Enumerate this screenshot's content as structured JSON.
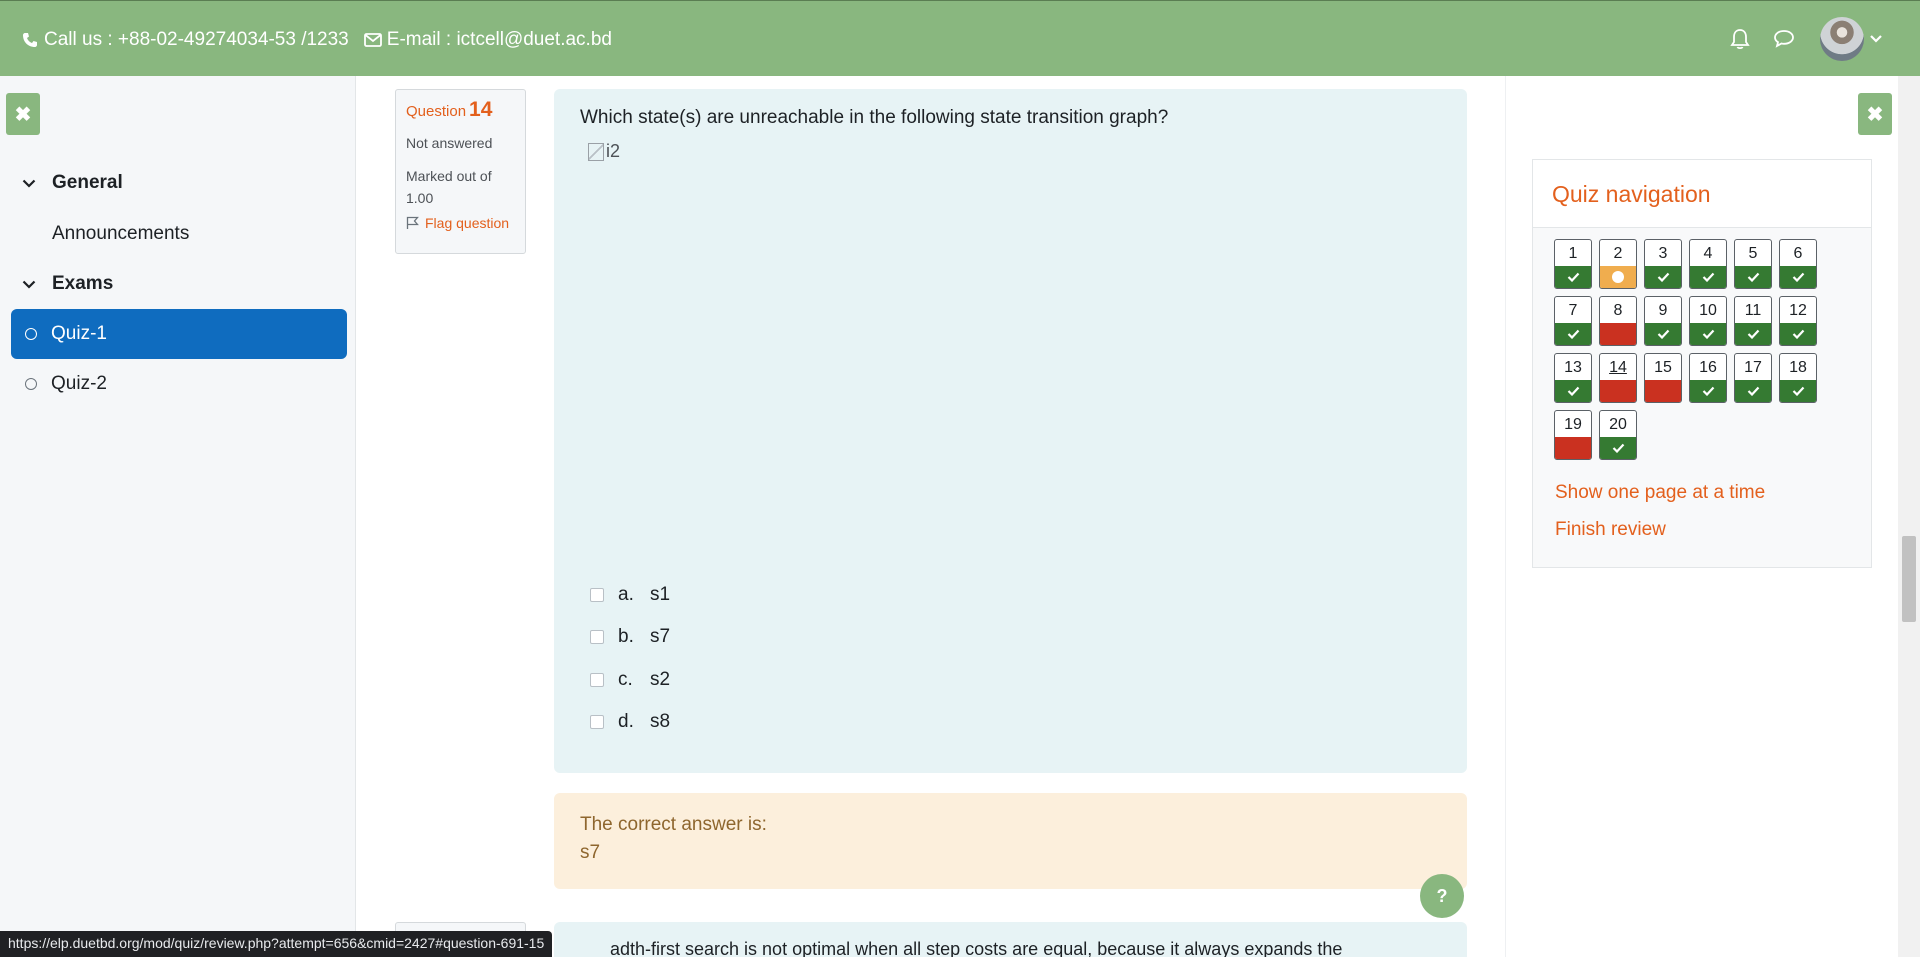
{
  "header": {
    "phone_label": "Call us : +88-02-49274034-53 /1233",
    "email_label": "E-mail : ictcell@duet.ac.bd",
    "icons": [
      "phone-icon",
      "envelope-icon",
      "bell-icon",
      "chat-icon",
      "avatar",
      "chevron-down-icon"
    ],
    "bg_color": "#89b77f"
  },
  "drawer": {
    "close_icon": "close-icon",
    "sections": [
      {
        "label": "General",
        "items": [
          "Announcements"
        ]
      },
      {
        "label": "Exams",
        "items": [
          "Quiz-1",
          "Quiz-2"
        ]
      }
    ],
    "general_label": "General",
    "announcements_label": "Announcements",
    "exams_label": "Exams",
    "quiz1_label": "Quiz-1",
    "quiz2_label": "Quiz-2",
    "active_item": "Quiz-1",
    "active_color": "#0f6cbf"
  },
  "question": {
    "prefix": "Question",
    "number": "14",
    "state": "Not answered",
    "grade_line1": "Marked out of",
    "grade_line2": "1.00",
    "flag_label": "Flag question",
    "text": "Which state(s) are unreachable in the following state transition graph?",
    "image_alt": "i2",
    "answers": [
      {
        "letter": "a.",
        "text": "s1"
      },
      {
        "letter": "b.",
        "text": "s7"
      },
      {
        "letter": "c.",
        "text": "s2"
      },
      {
        "letter": "d.",
        "text": "s8"
      }
    ],
    "feedback_label": "The correct answer is:",
    "feedback_answer": "s7"
  },
  "next_question": {
    "text_partial": "adth-first search is not optimal when all step costs are equal, because it always expands the"
  },
  "help_label": "?",
  "quiz_navigation": {
    "title": "Quiz navigation",
    "questions": [
      {
        "n": "1",
        "status": "correct"
      },
      {
        "n": "2",
        "status": "partial"
      },
      {
        "n": "3",
        "status": "correct"
      },
      {
        "n": "4",
        "status": "correct"
      },
      {
        "n": "5",
        "status": "correct"
      },
      {
        "n": "6",
        "status": "correct"
      },
      {
        "n": "7",
        "status": "correct"
      },
      {
        "n": "8",
        "status": "incorrect"
      },
      {
        "n": "9",
        "status": "correct"
      },
      {
        "n": "10",
        "status": "correct"
      },
      {
        "n": "11",
        "status": "correct"
      },
      {
        "n": "12",
        "status": "correct"
      },
      {
        "n": "13",
        "status": "correct"
      },
      {
        "n": "14",
        "status": "incorrect",
        "current": true
      },
      {
        "n": "15",
        "status": "incorrect"
      },
      {
        "n": "16",
        "status": "correct"
      },
      {
        "n": "17",
        "status": "correct"
      },
      {
        "n": "18",
        "status": "correct"
      },
      {
        "n": "19",
        "status": "incorrect"
      },
      {
        "n": "20",
        "status": "correct"
      }
    ],
    "show_one_page_label": "Show one page at a time",
    "finish_review_label": "Finish review",
    "colors": {
      "correct": "#357a32",
      "incorrect": "#ca3120",
      "partial": "#f0ad4e",
      "link": "#e3601d"
    }
  },
  "status_bar": {
    "url": "https://elp.duetbd.org/mod/quiz/review.php?attempt=656&cmid=2427#question-691-15"
  }
}
